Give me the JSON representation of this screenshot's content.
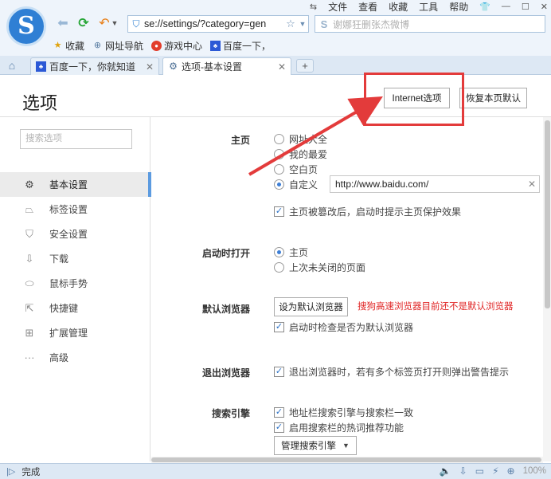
{
  "browser": {
    "address": "se://settings/?category=gen",
    "search_placeholder": "谢娜狂删张杰微博",
    "menu": [
      "文件",
      "查看",
      "收藏",
      "工具",
      "帮助"
    ],
    "favorites": [
      {
        "label": "收藏",
        "icon": "star-icon"
      },
      {
        "label": "网址导航",
        "icon": "globe-icon"
      },
      {
        "label": "游戏中心",
        "icon": "game-icon"
      },
      {
        "label": "百度一下，",
        "icon": "baidu-paw-icon"
      }
    ],
    "tabs": [
      {
        "label": "百度一下，你就知道",
        "icon": "baidu-paw-icon",
        "active": false
      },
      {
        "label": "选项-基本设置",
        "icon": "gear-icon",
        "active": true
      }
    ],
    "new_tab_label": "+"
  },
  "page": {
    "title": "选项",
    "internet_options_label": "Internet选项",
    "restore_defaults_label": "恢复本页默认"
  },
  "sidebar": {
    "search_placeholder": "搜索选项",
    "items": [
      {
        "label": "基本设置",
        "icon": "gear-icon",
        "active": true
      },
      {
        "label": "标签设置",
        "icon": "tab-icon",
        "active": false
      },
      {
        "label": "安全设置",
        "icon": "shield-icon",
        "active": false
      },
      {
        "label": "下载",
        "icon": "download-icon",
        "active": false
      },
      {
        "label": "鼠标手势",
        "icon": "mouse-icon",
        "active": false
      },
      {
        "label": "快捷键",
        "icon": "shortcut-icon",
        "active": false
      },
      {
        "label": "扩展管理",
        "icon": "extension-icon",
        "active": false
      },
      {
        "label": "高级",
        "icon": "more-icon",
        "active": false
      }
    ]
  },
  "settings": {
    "homepage": {
      "label": "主页",
      "options": [
        "网址大全",
        "我的最爱",
        "空白页",
        "自定义"
      ],
      "selected": "自定义",
      "custom_url": "http://www.baidu.com/",
      "protect_checkbox": "主页被篡改后，启动时提示主页保护效果",
      "protect_checked": true
    },
    "startup": {
      "label": "启动时打开",
      "options": [
        "主页",
        "上次未关闭的页面"
      ],
      "selected": "主页"
    },
    "default_browser": {
      "label": "默认浏览器",
      "button": "设为默认浏览器",
      "warning": "搜狗高速浏览器目前还不是默认浏览器",
      "check_label": "启动时检查是否为默认浏览器",
      "checked": true
    },
    "exit": {
      "label": "退出浏览器",
      "check_label": "退出浏览器时，若有多个标签页打开则弹出警告提示",
      "checked": true
    },
    "search_engine": {
      "label": "搜索引擎",
      "check1": "地址栏搜索引擎与搜索栏一致",
      "check1_checked": true,
      "check2": "启用搜索栏的热词推荐功能",
      "check2_checked": true,
      "manage_button": "管理搜索引擎"
    }
  },
  "status": {
    "text": "完成",
    "zoom": "100%"
  },
  "colors": {
    "accent": "#3e7fd6",
    "warning": "#e02424",
    "annotation": "#e33b3b"
  }
}
